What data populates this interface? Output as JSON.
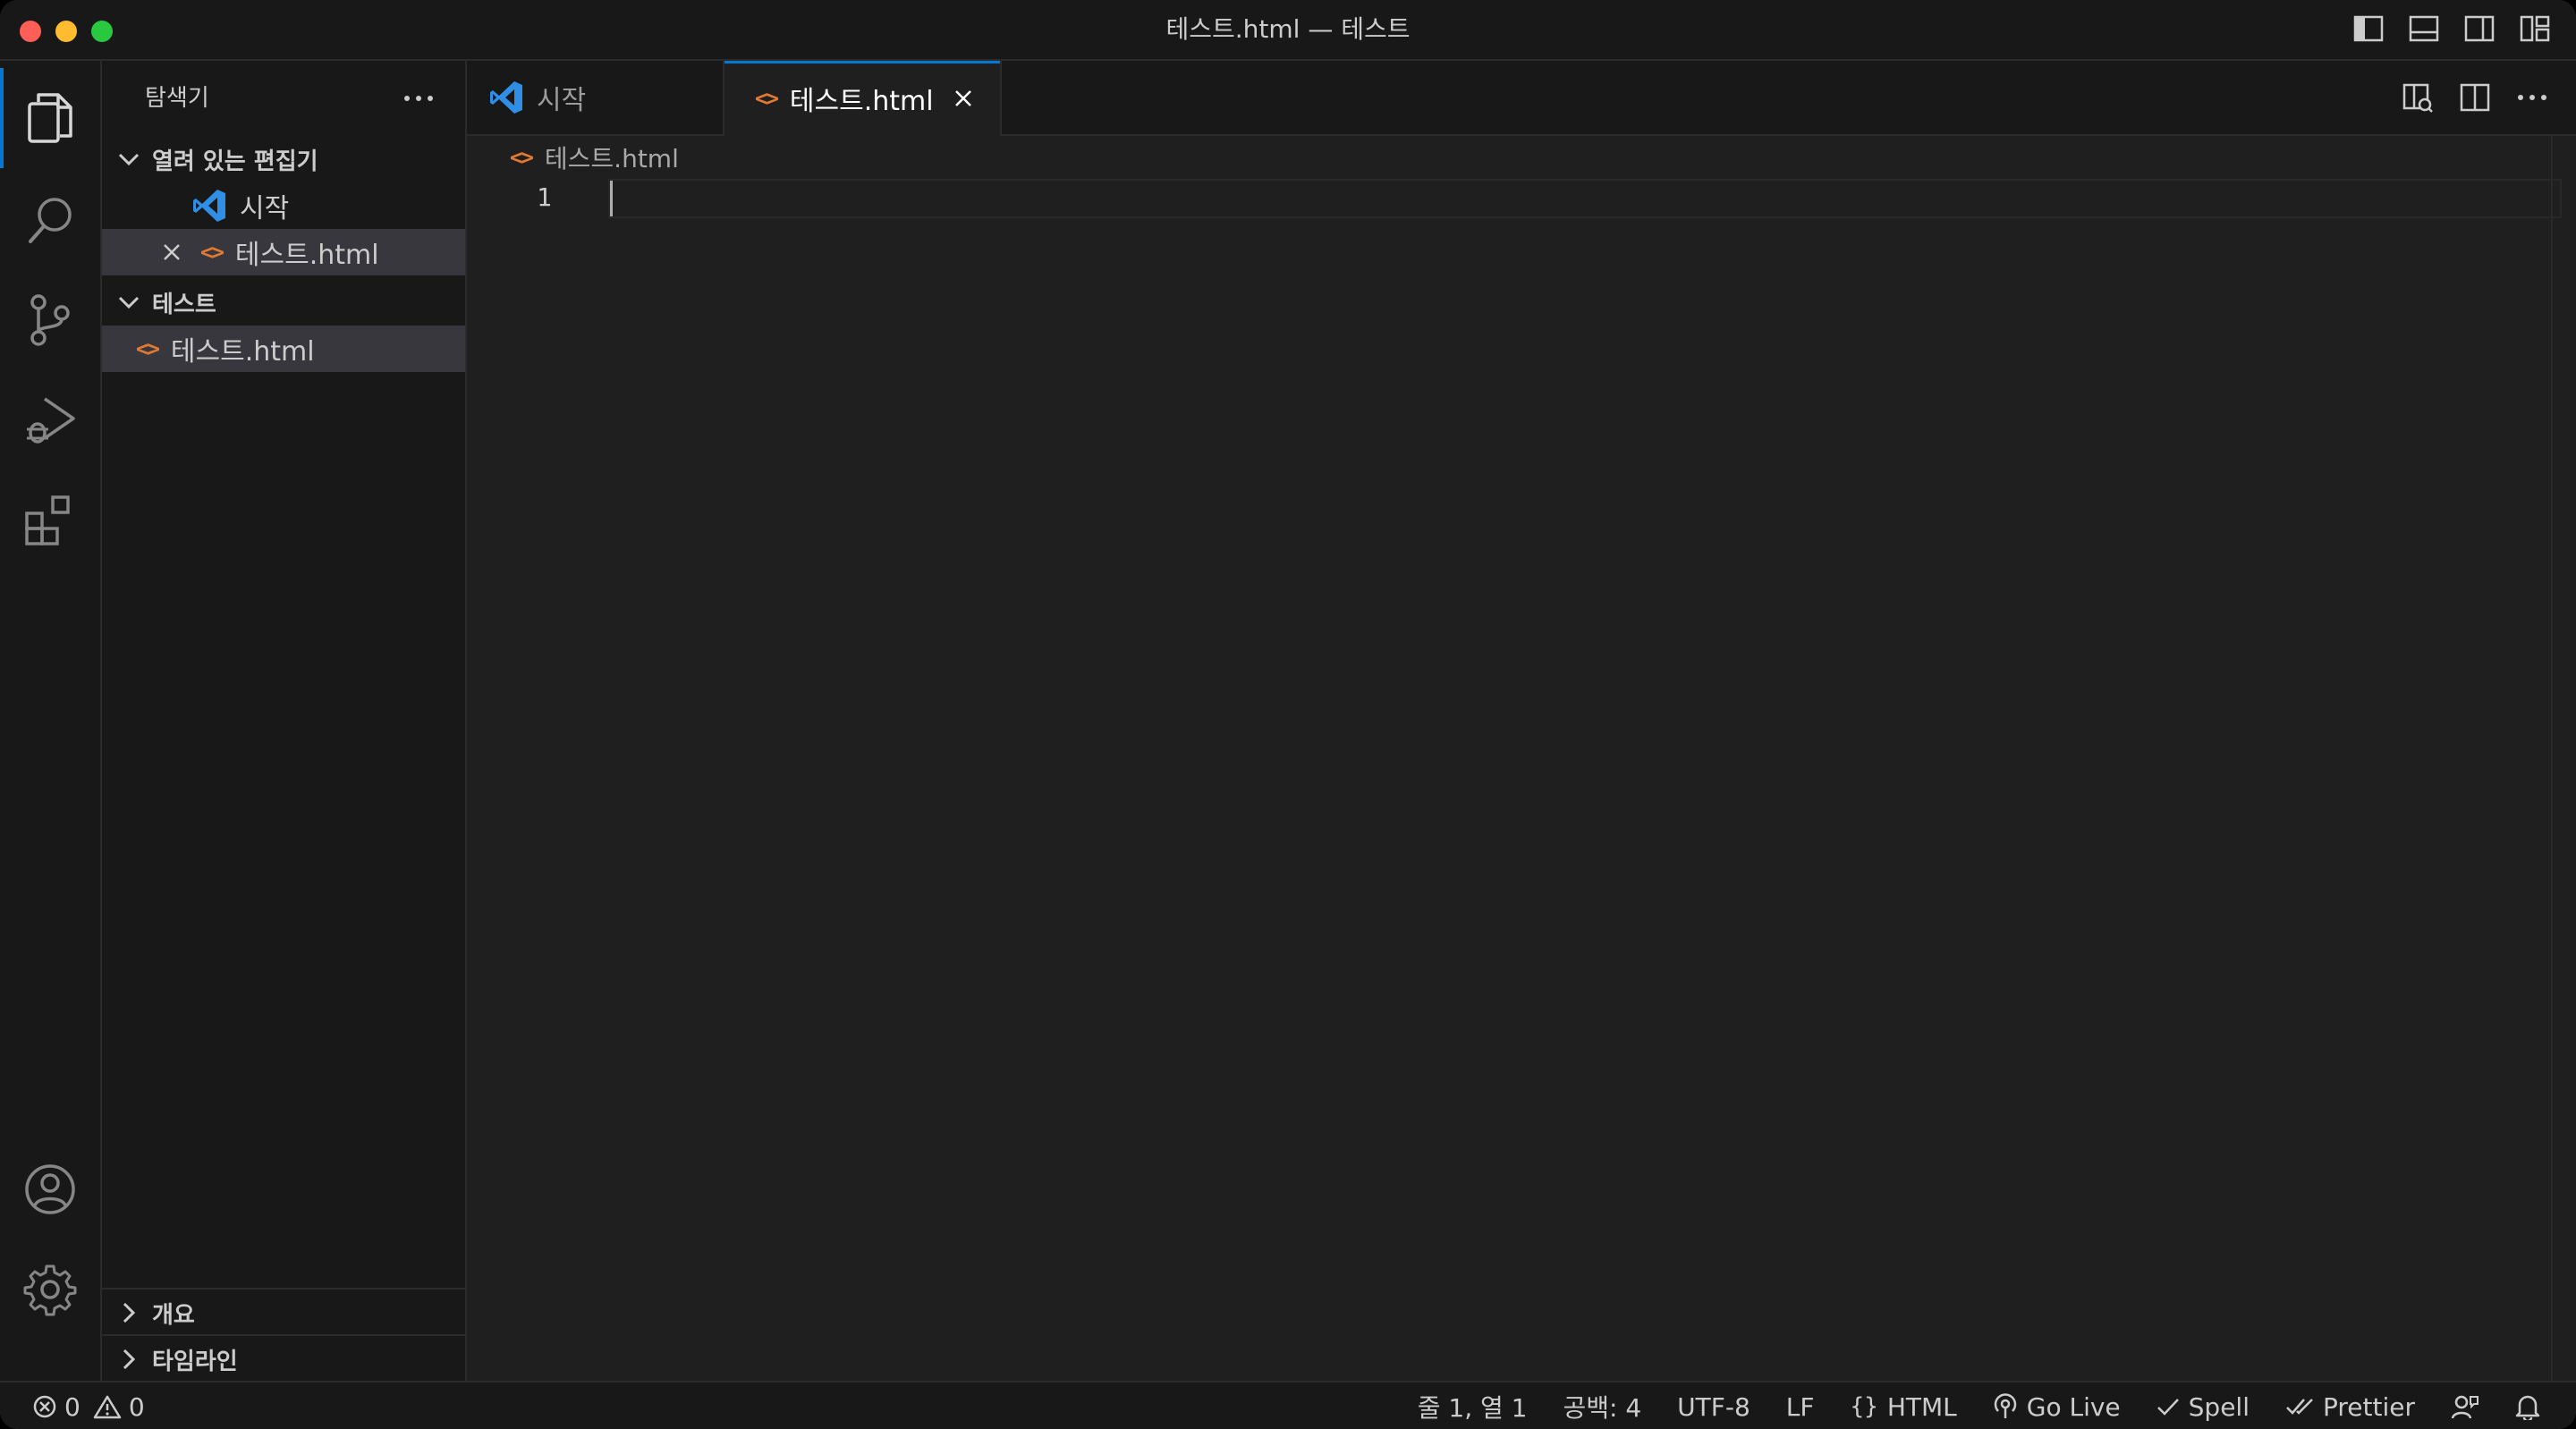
{
  "window": {
    "title": "테스트.html — 테스트"
  },
  "explorer": {
    "title": "탐색기",
    "more_label": "···",
    "open_editors": {
      "title": "열려 있는 편집기",
      "items": [
        {
          "label": "시작",
          "icon": "vscode-logo-icon"
        },
        {
          "label": "테스트.html",
          "icon": "html-file-icon",
          "selected": true
        }
      ]
    },
    "folder": {
      "title": "테스트",
      "items": [
        {
          "label": "테스트.html",
          "icon": "html-file-icon",
          "selected": true
        }
      ]
    },
    "outline_title": "개요",
    "timeline_title": "타임라인"
  },
  "tabs": [
    {
      "label": "시작",
      "active": false
    },
    {
      "label": "테스트.html",
      "active": true
    }
  ],
  "breadcrumb": {
    "file": "테스트.html"
  },
  "editor": {
    "line_numbers": [
      "1"
    ],
    "lines": [
      ""
    ]
  },
  "icons": {
    "code_glyph": "<>"
  },
  "status": {
    "errors": "0",
    "warnings": "0",
    "position": "줄 1, 열 1",
    "spaces": "공백: 4",
    "encoding": "UTF-8",
    "eol": "LF",
    "language": "HTML",
    "golive": "Go Live",
    "spell": "Spell",
    "prettier": "Prettier"
  },
  "colors": {
    "accent": "#0078d4",
    "html_icon": "#e37933",
    "vscode_blue": "#2f8ee5"
  }
}
